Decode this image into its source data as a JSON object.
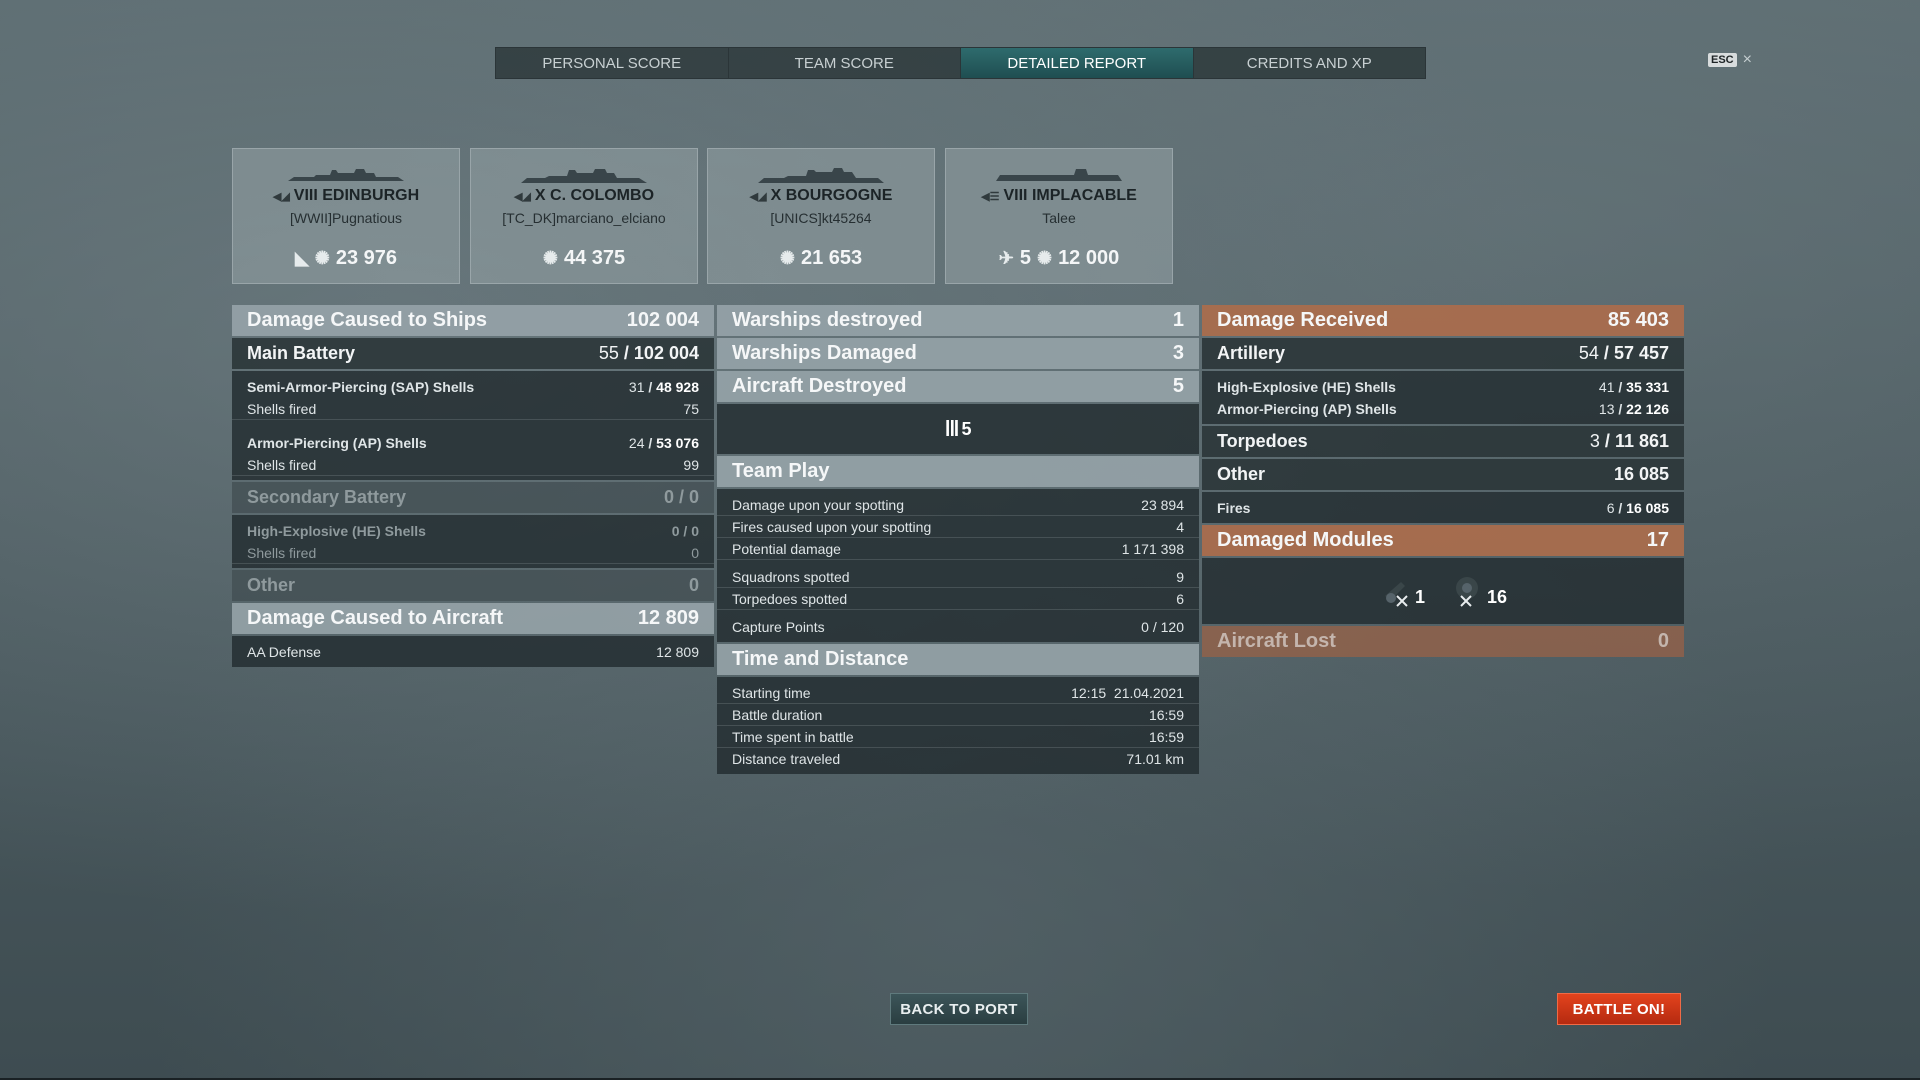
{
  "tabs": [
    {
      "label": "PERSONAL SCORE",
      "active": false
    },
    {
      "label": "TEAM SCORE",
      "active": false
    },
    {
      "label": "DETAILED REPORT",
      "active": true
    },
    {
      "label": "CREDITS AND XP",
      "active": false
    }
  ],
  "esc": {
    "key": "ESC",
    "close": "×"
  },
  "cards": [
    {
      "tier": "VIII",
      "name": "EDINBURGH",
      "player": "[WWII]Pugnatious",
      "counts": [
        "23 976"
      ]
    },
    {
      "tier": "X",
      "name": "C. COLOMBO",
      "player": "[TC_DK]marciano_elciano",
      "counts": [
        "44 375"
      ]
    },
    {
      "tier": "X",
      "name": "BOURGOGNE",
      "player": "[UNICS]kt45264",
      "counts": [
        "21 653"
      ]
    },
    {
      "tier": "VIII",
      "name": "IMPLACABLE",
      "player": "Talee",
      "counts": [
        "5",
        "12 000"
      ]
    }
  ],
  "left": {
    "damage_ships": {
      "label": "Damage Caused to Ships",
      "value": "102 004"
    },
    "main_battery": {
      "label": "Main Battery",
      "hits": "55",
      "value": "102 004"
    },
    "sap": {
      "label": "Semi-Armor-Piercing (SAP) Shells",
      "hits": "31",
      "value": "48 928",
      "fired_label": "Shells fired",
      "fired": "75"
    },
    "ap": {
      "label": "Armor-Piercing (AP) Shells",
      "hits": "24",
      "value": "53 076",
      "fired_label": "Shells fired",
      "fired": "99"
    },
    "secondary": {
      "label": "Secondary Battery",
      "value": "0 / 0"
    },
    "he": {
      "label": "High-Explosive (HE) Shells",
      "value": "0 / 0",
      "fired_label": "Shells fired",
      "fired": "0"
    },
    "other": {
      "label": "Other",
      "value": "0"
    },
    "damage_aircraft": {
      "label": "Damage Caused to Aircraft",
      "value": "12 809"
    },
    "aa": {
      "label": "AA Defense",
      "value": "12 809"
    }
  },
  "middle": {
    "warships_destroyed": {
      "label": "Warships destroyed",
      "value": "1"
    },
    "warships_damaged": {
      "label": "Warships Damaged",
      "value": "3"
    },
    "aircraft_destroyed": {
      "label": "Aircraft Destroyed",
      "value": "5"
    },
    "aircraft_icon_count": "5",
    "team_play": {
      "label": "Team Play",
      "rows1": [
        {
          "label": "Damage upon your spotting",
          "value": "23 894"
        },
        {
          "label": "Fires caused upon your spotting",
          "value": "4"
        },
        {
          "label": "Potential damage",
          "value": "1 171 398"
        }
      ],
      "rows2": [
        {
          "label": "Squadrons spotted",
          "value": "9"
        },
        {
          "label": "Torpedoes spotted",
          "value": "6"
        }
      ],
      "capture": {
        "label": "Capture Points",
        "value": "0 / 120"
      }
    },
    "time": {
      "label": "Time and Distance",
      "rows": [
        {
          "label": "Starting time",
          "value": "12:15  21.04.2021"
        },
        {
          "label": "Battle duration",
          "value": "16:59"
        },
        {
          "label": "Time spent in battle",
          "value": "16:59"
        },
        {
          "label": "Distance traveled",
          "value": "71.01 km"
        }
      ]
    }
  },
  "right": {
    "damage_received": {
      "label": "Damage Received",
      "value": "85 403"
    },
    "artillery": {
      "label": "Artillery",
      "hits": "54",
      "value": "57 457"
    },
    "he": {
      "label": "High-Explosive (HE) Shells",
      "hits": "41",
      "value": "35 331"
    },
    "ap": {
      "label": "Armor-Piercing (AP) Shells",
      "hits": "13",
      "value": "22 126"
    },
    "torpedoes": {
      "label": "Torpedoes",
      "hits": "3",
      "value": "11 861"
    },
    "other": {
      "label": "Other",
      "value": "16 085"
    },
    "fires": {
      "label": "Fires",
      "hits": "6",
      "value": "16 085"
    },
    "damaged_modules": {
      "label": "Damaged Modules",
      "value": "17"
    },
    "modules": [
      {
        "icon": "gun-module-icon",
        "count": "1"
      },
      {
        "icon": "engine-module-icon",
        "count": "16"
      }
    ],
    "aircraft_lost": {
      "label": "Aircraft Lost",
      "value": "0"
    }
  },
  "buttons": {
    "back": "BACK TO PORT",
    "battle": "BATTLE ON!"
  }
}
